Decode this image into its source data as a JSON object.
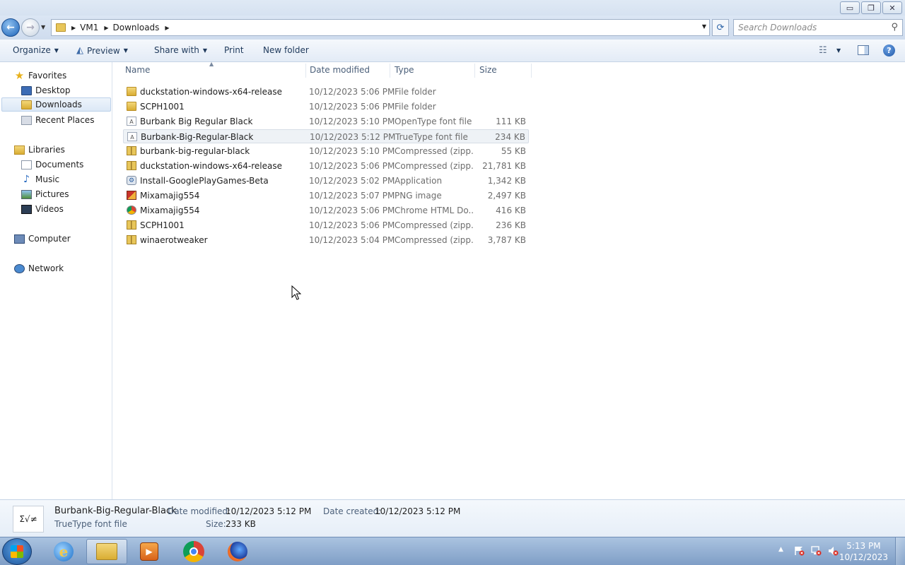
{
  "window": {
    "minimize": "▭",
    "restore": "❐",
    "close": "✕"
  },
  "address": {
    "crumbs": [
      "VM1",
      "Downloads"
    ],
    "search_placeholder": "Search Downloads"
  },
  "toolbar": {
    "organize": "Organize",
    "preview": "Preview",
    "share_with": "Share with",
    "print": "Print",
    "new_folder": "New folder"
  },
  "nav": {
    "favorites": "Favorites",
    "desktop": "Desktop",
    "downloads": "Downloads",
    "recent_places": "Recent Places",
    "libraries": "Libraries",
    "documents": "Documents",
    "music": "Music",
    "pictures": "Pictures",
    "videos": "Videos",
    "computer": "Computer",
    "network": "Network"
  },
  "columns": {
    "name": "Name",
    "date_modified": "Date modified",
    "type": "Type",
    "size": "Size"
  },
  "files": [
    {
      "name": "duckstation-windows-x64-release",
      "date": "10/12/2023 5:06 PM",
      "type": "File folder",
      "size": "",
      "icon": "folder-icon"
    },
    {
      "name": "SCPH1001",
      "date": "10/12/2023 5:06 PM",
      "type": "File folder",
      "size": "",
      "icon": "folder-icon"
    },
    {
      "name": "Burbank Big Regular Black",
      "date": "10/12/2023 5:10 PM",
      "type": "OpenType font file",
      "size": "111 KB",
      "icon": "font-file-icon"
    },
    {
      "name": "Burbank-Big-Regular-Black",
      "date": "10/12/2023 5:12 PM",
      "type": "TrueType font file",
      "size": "234 KB",
      "icon": "font-file-icon"
    },
    {
      "name": "burbank-big-regular-black",
      "date": "10/12/2023 5:10 PM",
      "type": "Compressed (zipp...",
      "size": "55 KB",
      "icon": "zip-icon"
    },
    {
      "name": "duckstation-windows-x64-release",
      "date": "10/12/2023 5:06 PM",
      "type": "Compressed (zipp...",
      "size": "21,781 KB",
      "icon": "zip-icon"
    },
    {
      "name": "Install-GooglePlayGames-Beta",
      "date": "10/12/2023 5:02 PM",
      "type": "Application",
      "size": "1,342 KB",
      "icon": "app-icon"
    },
    {
      "name": "Mixamajig554",
      "date": "10/12/2023 5:07 PM",
      "type": "PNG image",
      "size": "2,497 KB",
      "icon": "png-icon"
    },
    {
      "name": "Mixamajig554",
      "date": "10/12/2023 5:06 PM",
      "type": "Chrome HTML Do...",
      "size": "416 KB",
      "icon": "chrome-icon"
    },
    {
      "name": "SCPH1001",
      "date": "10/12/2023 5:06 PM",
      "type": "Compressed (zipp...",
      "size": "236 KB",
      "icon": "zip-icon"
    },
    {
      "name": "winaerotweaker",
      "date": "10/12/2023 5:04 PM",
      "type": "Compressed (zipp...",
      "size": "3,787 KB",
      "icon": "zip-icon"
    }
  ],
  "selected_index": 3,
  "details": {
    "thumb_glyph": "Σ√≠",
    "name": "Burbank-Big-Regular-Black",
    "type": "TrueType font file",
    "date_modified_label": "Date modified:",
    "date_modified": "10/12/2023 5:12 PM",
    "date_created_label": "Date created:",
    "date_created": "10/12/2023 5:12 PM",
    "size_label": "Size:",
    "size": "233 KB"
  },
  "taskbar": {
    "time": "5:13 PM",
    "date": "10/12/2023",
    "ie_glyph": "e"
  }
}
